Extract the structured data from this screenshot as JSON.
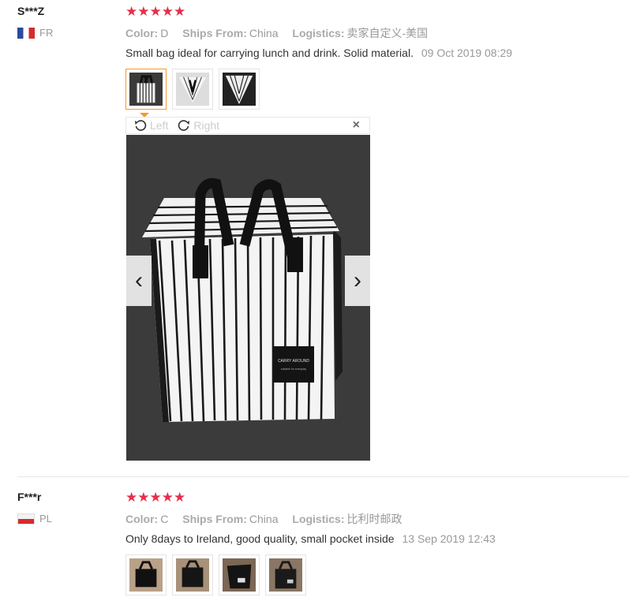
{
  "reviews": [
    {
      "user": "S***Z",
      "country": "FR",
      "stars": "★★★★★",
      "color_label": "Color:",
      "color_value": "D",
      "ships_label": "Ships From:",
      "ships_value": "China",
      "logistics_label": "Logistics:",
      "logistics_value": "卖家自定义-美国",
      "feedback": "Small bag ideal for carrying lunch and drink. Solid material.",
      "date": "09 Oct 2019 08:29",
      "thumbnail_count": 3
    },
    {
      "user": "F***r",
      "country": "PL",
      "stars": "★★★★★",
      "color_label": "Color:",
      "color_value": "C",
      "ships_label": "Ships From:",
      "ships_value": "China",
      "logistics_label": "Logistics:",
      "logistics_value": "比利时邮政",
      "feedback": "Only 8days to Ireland, good quality, small pocket inside",
      "date": "13 Sep 2019 12:43",
      "thumbnail_count": 4
    }
  ],
  "viewer": {
    "rotate_left": "Left",
    "rotate_right": "Right",
    "close": "×",
    "prev": "‹",
    "next": "›",
    "bag_label_1": "CARRY AROUND",
    "bag_label_2": "suitable for everyday"
  },
  "colors": {
    "star": "#e62e4a",
    "active_thumb_border": "#f59a2b"
  }
}
